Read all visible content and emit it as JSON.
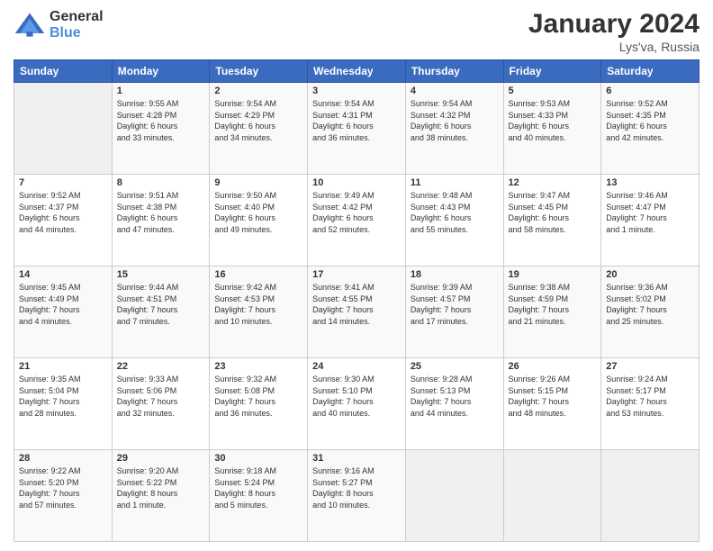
{
  "logo": {
    "general": "General",
    "blue": "Blue"
  },
  "header": {
    "month": "January 2024",
    "location": "Lys'va, Russia"
  },
  "weekdays": [
    "Sunday",
    "Monday",
    "Tuesday",
    "Wednesday",
    "Thursday",
    "Friday",
    "Saturday"
  ],
  "weeks": [
    [
      {
        "day": "",
        "info": ""
      },
      {
        "day": "1",
        "info": "Sunrise: 9:55 AM\nSunset: 4:28 PM\nDaylight: 6 hours\nand 33 minutes."
      },
      {
        "day": "2",
        "info": "Sunrise: 9:54 AM\nSunset: 4:29 PM\nDaylight: 6 hours\nand 34 minutes."
      },
      {
        "day": "3",
        "info": "Sunrise: 9:54 AM\nSunset: 4:31 PM\nDaylight: 6 hours\nand 36 minutes."
      },
      {
        "day": "4",
        "info": "Sunrise: 9:54 AM\nSunset: 4:32 PM\nDaylight: 6 hours\nand 38 minutes."
      },
      {
        "day": "5",
        "info": "Sunrise: 9:53 AM\nSunset: 4:33 PM\nDaylight: 6 hours\nand 40 minutes."
      },
      {
        "day": "6",
        "info": "Sunrise: 9:52 AM\nSunset: 4:35 PM\nDaylight: 6 hours\nand 42 minutes."
      }
    ],
    [
      {
        "day": "7",
        "info": "Sunrise: 9:52 AM\nSunset: 4:37 PM\nDaylight: 6 hours\nand 44 minutes."
      },
      {
        "day": "8",
        "info": "Sunrise: 9:51 AM\nSunset: 4:38 PM\nDaylight: 6 hours\nand 47 minutes."
      },
      {
        "day": "9",
        "info": "Sunrise: 9:50 AM\nSunset: 4:40 PM\nDaylight: 6 hours\nand 49 minutes."
      },
      {
        "day": "10",
        "info": "Sunrise: 9:49 AM\nSunset: 4:42 PM\nDaylight: 6 hours\nand 52 minutes."
      },
      {
        "day": "11",
        "info": "Sunrise: 9:48 AM\nSunset: 4:43 PM\nDaylight: 6 hours\nand 55 minutes."
      },
      {
        "day": "12",
        "info": "Sunrise: 9:47 AM\nSunset: 4:45 PM\nDaylight: 6 hours\nand 58 minutes."
      },
      {
        "day": "13",
        "info": "Sunrise: 9:46 AM\nSunset: 4:47 PM\nDaylight: 7 hours\nand 1 minute."
      }
    ],
    [
      {
        "day": "14",
        "info": "Sunrise: 9:45 AM\nSunset: 4:49 PM\nDaylight: 7 hours\nand 4 minutes."
      },
      {
        "day": "15",
        "info": "Sunrise: 9:44 AM\nSunset: 4:51 PM\nDaylight: 7 hours\nand 7 minutes."
      },
      {
        "day": "16",
        "info": "Sunrise: 9:42 AM\nSunset: 4:53 PM\nDaylight: 7 hours\nand 10 minutes."
      },
      {
        "day": "17",
        "info": "Sunrise: 9:41 AM\nSunset: 4:55 PM\nDaylight: 7 hours\nand 14 minutes."
      },
      {
        "day": "18",
        "info": "Sunrise: 9:39 AM\nSunset: 4:57 PM\nDaylight: 7 hours\nand 17 minutes."
      },
      {
        "day": "19",
        "info": "Sunrise: 9:38 AM\nSunset: 4:59 PM\nDaylight: 7 hours\nand 21 minutes."
      },
      {
        "day": "20",
        "info": "Sunrise: 9:36 AM\nSunset: 5:02 PM\nDaylight: 7 hours\nand 25 minutes."
      }
    ],
    [
      {
        "day": "21",
        "info": "Sunrise: 9:35 AM\nSunset: 5:04 PM\nDaylight: 7 hours\nand 28 minutes."
      },
      {
        "day": "22",
        "info": "Sunrise: 9:33 AM\nSunset: 5:06 PM\nDaylight: 7 hours\nand 32 minutes."
      },
      {
        "day": "23",
        "info": "Sunrise: 9:32 AM\nSunset: 5:08 PM\nDaylight: 7 hours\nand 36 minutes."
      },
      {
        "day": "24",
        "info": "Sunrise: 9:30 AM\nSunset: 5:10 PM\nDaylight: 7 hours\nand 40 minutes."
      },
      {
        "day": "25",
        "info": "Sunrise: 9:28 AM\nSunset: 5:13 PM\nDaylight: 7 hours\nand 44 minutes."
      },
      {
        "day": "26",
        "info": "Sunrise: 9:26 AM\nSunset: 5:15 PM\nDaylight: 7 hours\nand 48 minutes."
      },
      {
        "day": "27",
        "info": "Sunrise: 9:24 AM\nSunset: 5:17 PM\nDaylight: 7 hours\nand 53 minutes."
      }
    ],
    [
      {
        "day": "28",
        "info": "Sunrise: 9:22 AM\nSunset: 5:20 PM\nDaylight: 7 hours\nand 57 minutes."
      },
      {
        "day": "29",
        "info": "Sunrise: 9:20 AM\nSunset: 5:22 PM\nDaylight: 8 hours\nand 1 minute."
      },
      {
        "day": "30",
        "info": "Sunrise: 9:18 AM\nSunset: 5:24 PM\nDaylight: 8 hours\nand 5 minutes."
      },
      {
        "day": "31",
        "info": "Sunrise: 9:16 AM\nSunset: 5:27 PM\nDaylight: 8 hours\nand 10 minutes."
      },
      {
        "day": "",
        "info": ""
      },
      {
        "day": "",
        "info": ""
      },
      {
        "day": "",
        "info": ""
      }
    ]
  ]
}
